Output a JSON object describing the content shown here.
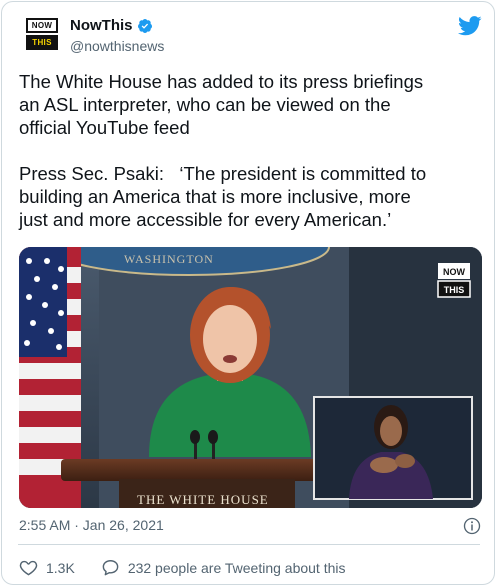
{
  "account": {
    "display_name": "NowThis",
    "handle": "@nowthisnews",
    "avatar_top": "NOW",
    "avatar_bottom": "THIS"
  },
  "tweet": {
    "text": "The White House has added to its press briefings\nan ASL interpreter, who can be viewed on the\nofficial YouTube feed\n\nPress Sec. Psaki:   ‘The president is committed to\nbuilding an America that is more inclusive, more\njust and more accessible for every American.’",
    "timestamp": "2:55 AM · Jan 26, 2021"
  },
  "media": {
    "backdrop_text": "WASHINGTON",
    "podium_text": "THE WHITE HOUSE",
    "badge_top": "NOW",
    "badge_bottom": "THIS"
  },
  "actions": {
    "likes": "1.3K",
    "conversation": "232 people are Tweeting about this"
  },
  "colors": {
    "verified": "#1d9bf0",
    "twitter_blue": "#1d9bf0",
    "secondary_text": "#536471",
    "border": "#cfd9de"
  },
  "icons": [
    "verified-badge-icon",
    "twitter-bird-icon",
    "info-icon",
    "heart-icon",
    "speech-bubble-icon"
  ]
}
